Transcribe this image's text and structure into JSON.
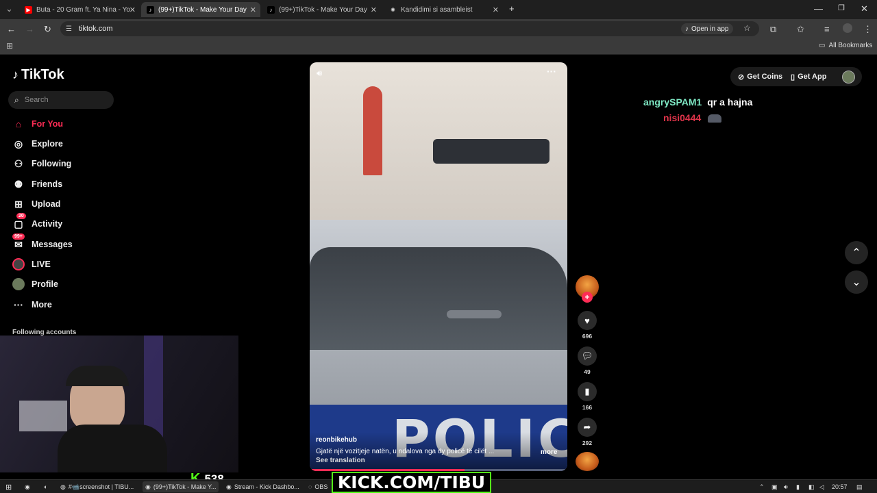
{
  "browser": {
    "tabs": [
      {
        "title": "Buta - 20 Gram ft. Ya Nina - Yo",
        "icon": "youtube-icon"
      },
      {
        "title": "(99+)TikTok - Make Your Day",
        "icon": "tiktok-icon"
      },
      {
        "title": "(99+)TikTok - Make Your Day",
        "icon": "tiktok-icon"
      },
      {
        "title": "Kandidimi si asambleist",
        "icon": "chatgpt-icon"
      }
    ],
    "url": "tiktok.com",
    "open_in_app": "Open in app",
    "all_bookmarks": "All Bookmarks"
  },
  "tiktok": {
    "logo": "TikTok",
    "search_placeholder": "Search",
    "nav": [
      {
        "label": "For You",
        "icon": "home-icon",
        "active": true
      },
      {
        "label": "Explore",
        "icon": "compass-icon"
      },
      {
        "label": "Following",
        "icon": "following-icon"
      },
      {
        "label": "Friends",
        "icon": "friends-icon"
      },
      {
        "label": "Upload",
        "icon": "upload-icon"
      },
      {
        "label": "Activity",
        "icon": "activity-icon",
        "badge": "20"
      },
      {
        "label": "Messages",
        "icon": "messages-icon",
        "badge": "99+"
      },
      {
        "label": "LIVE",
        "icon": "live-icon"
      },
      {
        "label": "Profile",
        "icon": "profile-avatar-icon"
      },
      {
        "label": "More",
        "icon": "more-icon"
      }
    ],
    "following_accounts": "Following accounts",
    "top_right": {
      "get_coins": "Get Coins",
      "get_app": "Get App"
    },
    "video": {
      "author": "reonbikehub",
      "caption": "Gjatë një vozitjeje natën, u ndalova nga dy policë të cilët ...",
      "more": "more",
      "see_translation": "See translation",
      "overlay_text": "POLIC",
      "progress": 0.6
    },
    "actions": {
      "likes": "696",
      "comments": "49",
      "saves": "166",
      "shares": "292"
    }
  },
  "chat": [
    {
      "user": "angrySPAM1",
      "message": "qr a hajna",
      "color": "#7ee8c4"
    },
    {
      "user": "nisi0444",
      "message": "",
      "color": "#e0344a"
    }
  ],
  "stream_overlay": {
    "viewer_count": "538",
    "banner": "KICK.COM/TIBU",
    "accent": "#53fc18"
  },
  "taskbar": {
    "items": [
      {
        "label": "#📹screenshot | TIBU..."
      },
      {
        "label": "(99+)TikTok - Make Y..."
      },
      {
        "label": "Stream - Kick Dashbo..."
      },
      {
        "label": "OBS"
      }
    ],
    "time": "20:57"
  },
  "colors": {
    "tiktok_red": "#fe2c55",
    "bg": "#000000"
  }
}
